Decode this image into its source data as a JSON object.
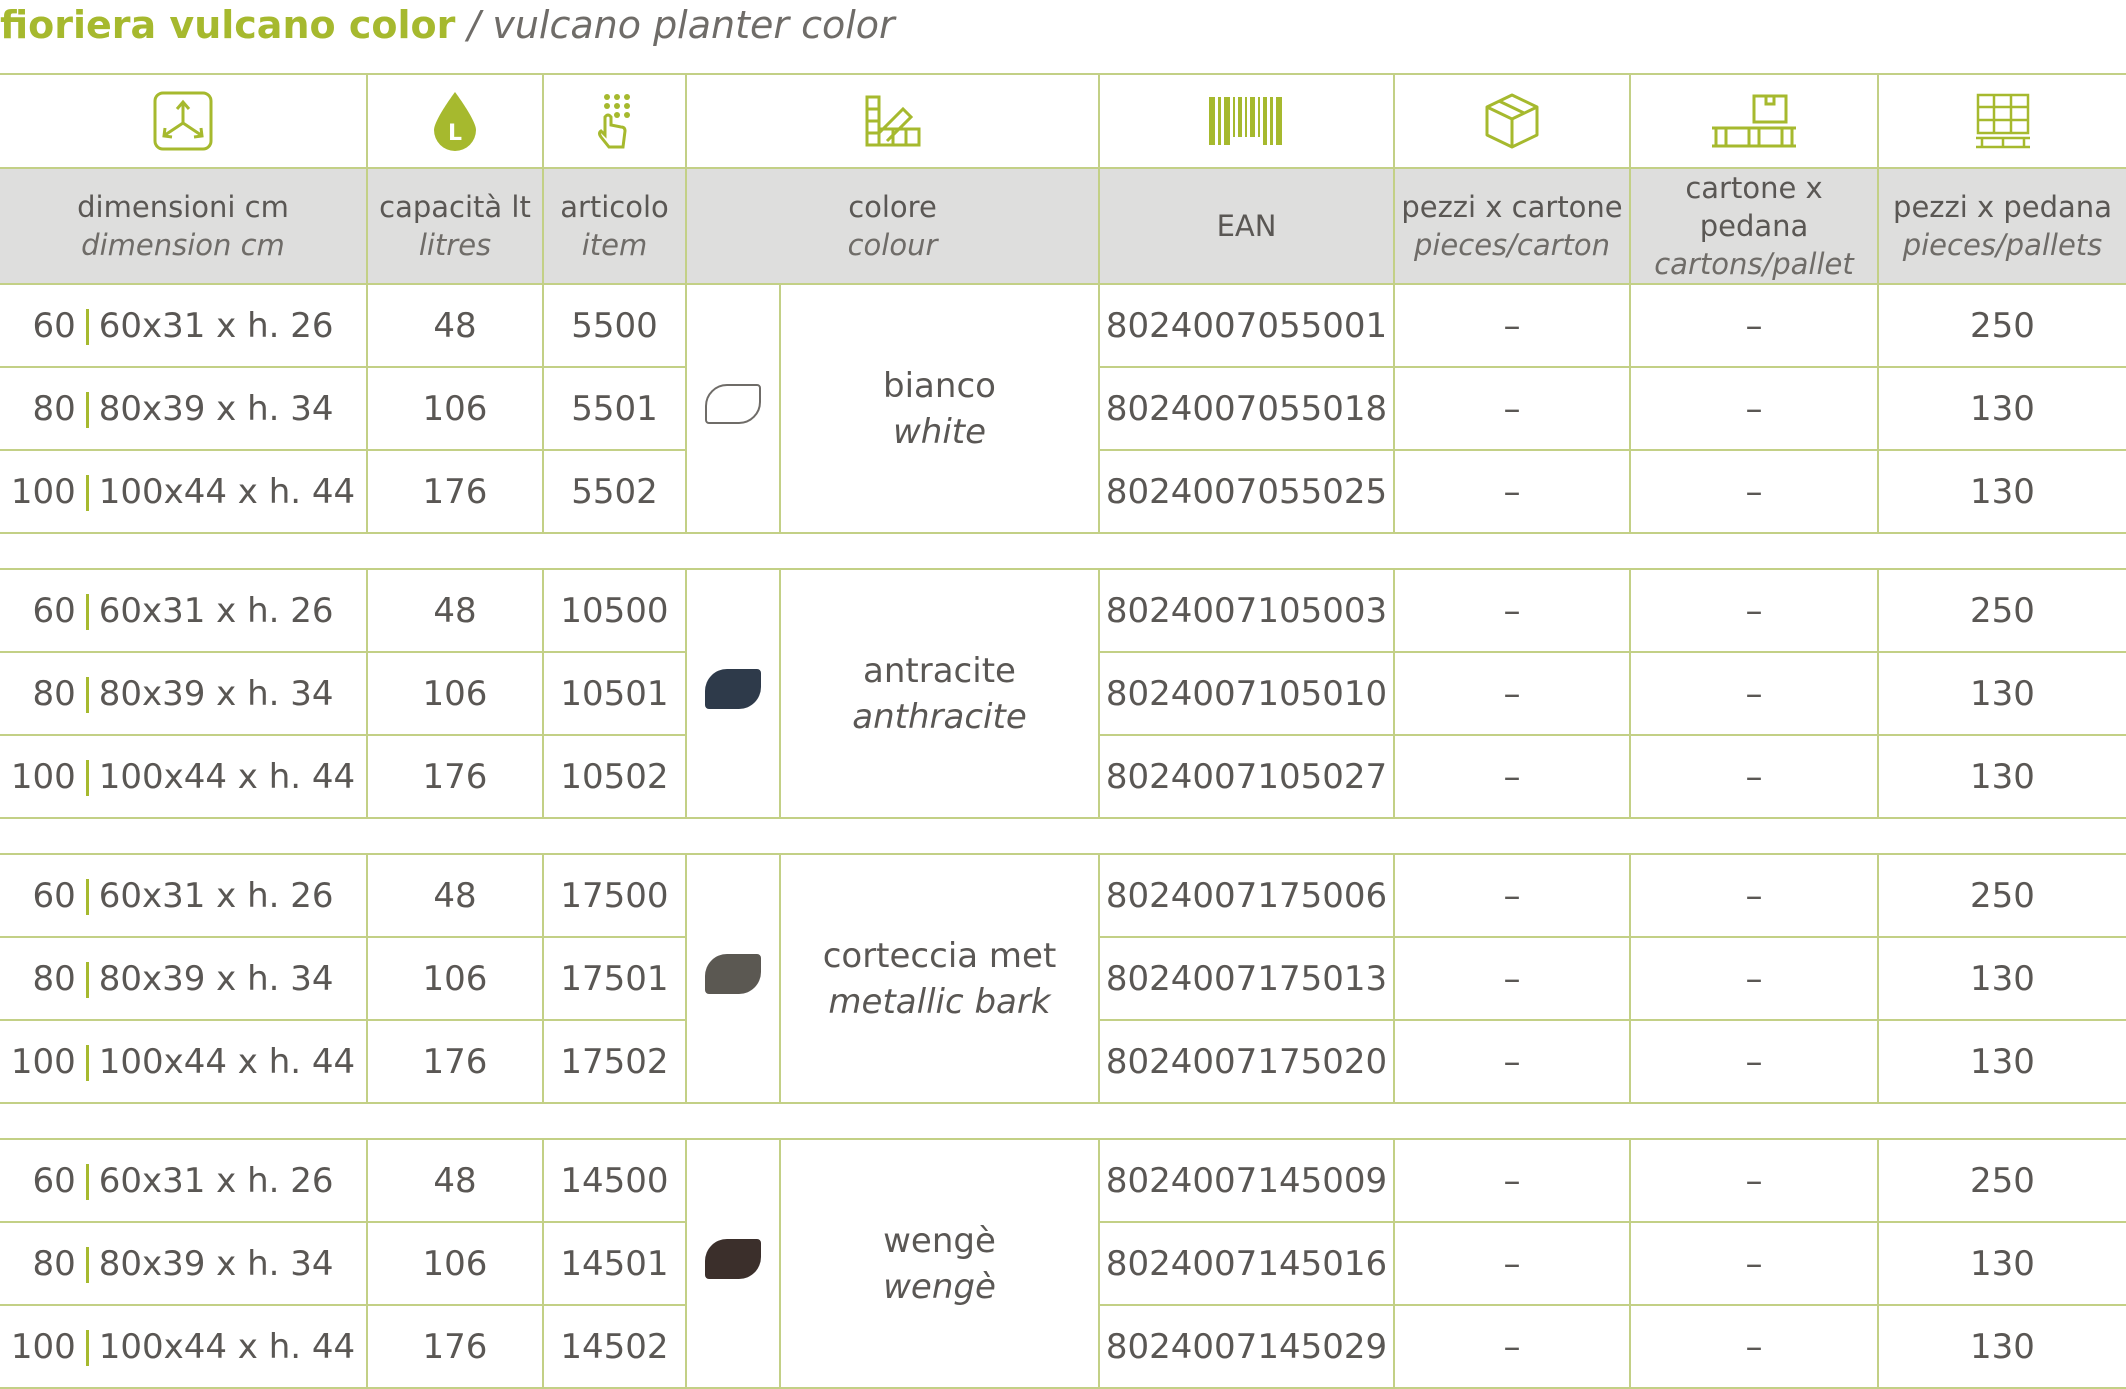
{
  "title": {
    "italian": "fioriera vulcano color",
    "separator": "/",
    "english": "vulcano planter color"
  },
  "accent_color": "#a6b92e",
  "border_color": "#c3d086",
  "header_bg": "#dededd",
  "icons": [
    "dimensions-arrows-icon",
    "liter-drop-icon",
    "keypad-hand-icon",
    "color-swatch-icon",
    "barcode-icon",
    "box-icon",
    "pallet-box-icon",
    "pallet-stack-icon"
  ],
  "headers": [
    {
      "main": "dimensioni cm",
      "sub": "dimension cm"
    },
    {
      "main": "capacità lt",
      "sub": "litres"
    },
    {
      "main": "articolo",
      "sub": "item"
    },
    {
      "main": "colore",
      "sub": "colour"
    },
    {
      "main": "EAN",
      "sub": ""
    },
    {
      "main": "pezzi x cartone",
      "sub": "pieces/carton"
    },
    {
      "main": "cartone x pedana",
      "sub": "cartons/pallet"
    },
    {
      "main": "pezzi x pedana",
      "sub": "pieces/pallets"
    }
  ],
  "groups": [
    {
      "color_it": "bianco",
      "color_en": "white",
      "swatch": "#ffffff",
      "rows": [
        {
          "size": "60",
          "dims": "60x31 x h. 26",
          "capacity": "48",
          "item": "5500",
          "ean": "8024007055001",
          "pcs_carton": "–",
          "cartons_pallet": "–",
          "pcs_pallet": "250"
        },
        {
          "size": "80",
          "dims": "80x39 x h. 34",
          "capacity": "106",
          "item": "5501",
          "ean": "8024007055018",
          "pcs_carton": "–",
          "cartons_pallet": "–",
          "pcs_pallet": "130"
        },
        {
          "size": "100",
          "dims": "100x44 x h. 44",
          "capacity": "176",
          "item": "5502",
          "ean": "8024007055025",
          "pcs_carton": "–",
          "cartons_pallet": "–",
          "pcs_pallet": "130"
        }
      ]
    },
    {
      "color_it": "antracite",
      "color_en": "anthracite",
      "swatch": "#2e3a4a",
      "rows": [
        {
          "size": "60",
          "dims": "60x31 x h. 26",
          "capacity": "48",
          "item": "10500",
          "ean": "8024007105003",
          "pcs_carton": "–",
          "cartons_pallet": "–",
          "pcs_pallet": "250"
        },
        {
          "size": "80",
          "dims": "80x39 x h. 34",
          "capacity": "106",
          "item": "10501",
          "ean": "8024007105010",
          "pcs_carton": "–",
          "cartons_pallet": "–",
          "pcs_pallet": "130"
        },
        {
          "size": "100",
          "dims": "100x44 x h. 44",
          "capacity": "176",
          "item": "10502",
          "ean": "8024007105027",
          "pcs_carton": "–",
          "cartons_pallet": "–",
          "pcs_pallet": "130"
        }
      ]
    },
    {
      "color_it": "corteccia met",
      "color_en": "metallic bark",
      "swatch": "#5b5852",
      "rows": [
        {
          "size": "60",
          "dims": "60x31 x h. 26",
          "capacity": "48",
          "item": "17500",
          "ean": "8024007175006",
          "pcs_carton": "–",
          "cartons_pallet": "–",
          "pcs_pallet": "250"
        },
        {
          "size": "80",
          "dims": "80x39 x h. 34",
          "capacity": "106",
          "item": "17501",
          "ean": "8024007175013",
          "pcs_carton": "–",
          "cartons_pallet": "–",
          "pcs_pallet": "130"
        },
        {
          "size": "100",
          "dims": "100x44 x h. 44",
          "capacity": "176",
          "item": "17502",
          "ean": "8024007175020",
          "pcs_carton": "–",
          "cartons_pallet": "–",
          "pcs_pallet": "130"
        }
      ]
    },
    {
      "color_it": "wengè",
      "color_en": "wengè",
      "swatch": "#3b2f2b",
      "rows": [
        {
          "size": "60",
          "dims": "60x31 x h. 26",
          "capacity": "48",
          "item": "14500",
          "ean": "8024007145009",
          "pcs_carton": "–",
          "cartons_pallet": "–",
          "pcs_pallet": "250"
        },
        {
          "size": "80",
          "dims": "80x39 x h. 34",
          "capacity": "106",
          "item": "14501",
          "ean": "8024007145016",
          "pcs_carton": "–",
          "cartons_pallet": "–",
          "pcs_pallet": "130"
        },
        {
          "size": "100",
          "dims": "100x44 x h. 44",
          "capacity": "176",
          "item": "14502",
          "ean": "8024007145029",
          "pcs_carton": "–",
          "cartons_pallet": "–",
          "pcs_pallet": "130"
        }
      ]
    }
  ]
}
